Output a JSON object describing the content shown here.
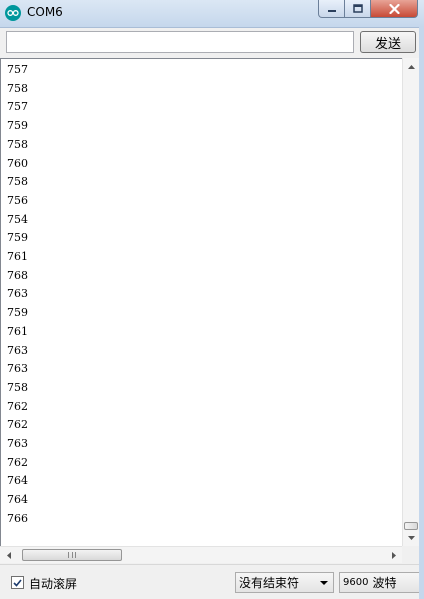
{
  "window": {
    "title": "COM6"
  },
  "toolbar": {
    "input_value": "",
    "send_label": "发送"
  },
  "output": {
    "lines": [
      "757",
      "758",
      "757",
      "759",
      "758",
      "760",
      "758",
      "756",
      "754",
      "759",
      "761",
      "768",
      "763",
      "759",
      "761",
      "763",
      "763",
      "758",
      "762",
      "762",
      "763",
      "762",
      "764",
      "764",
      "766"
    ]
  },
  "footer": {
    "autoscroll_label": "自动滚屏",
    "autoscroll_checked": true,
    "line_ending": "没有结束符",
    "baud_value": "9600",
    "baud_unit": "波特"
  },
  "colors": {
    "arduino_teal": "#00979c",
    "close_red": "#c74a36"
  },
  "icons": {
    "app": "arduino-infinity-icon",
    "minimize": "minimize-icon",
    "maximize": "maximize-icon",
    "close": "close-icon"
  }
}
